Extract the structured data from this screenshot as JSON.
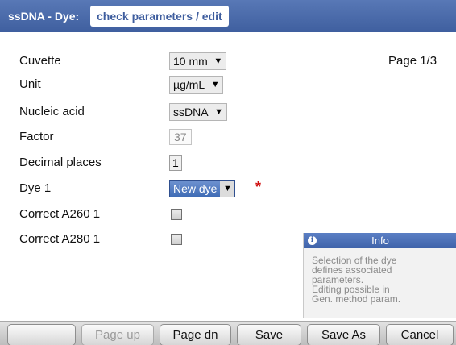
{
  "header": {
    "prefix": "ssDNA - Dye:",
    "tab": "check parameters / edit"
  },
  "page_indicator": "Page 1/3",
  "form": {
    "cuvette": {
      "label": "Cuvette",
      "value": "10 mm"
    },
    "unit": {
      "label": "Unit",
      "value": "µg/mL"
    },
    "nucleic_acid": {
      "label": "Nucleic acid",
      "value": "ssDNA"
    },
    "factor": {
      "label": "Factor",
      "value": "37"
    },
    "decimal_places": {
      "label": "Decimal places",
      "value": "1"
    },
    "dye1": {
      "label": "Dye 1",
      "value": "New dye",
      "required_mark": "*"
    },
    "correct_a260": {
      "label": "Correct A260 1",
      "checked": false
    },
    "correct_a280": {
      "label": "Correct A280 1",
      "checked": false
    }
  },
  "info": {
    "icon": "info-icon",
    "title": "Info",
    "text": "Selection of the dye\ndefines associated\nparameters.\nEditing possible in\nGen. method param."
  },
  "buttons": {
    "blank": "",
    "page_up": "Page up",
    "page_dn": "Page dn",
    "save": "Save",
    "save_as": "Save As",
    "cancel": "Cancel"
  },
  "colors": {
    "header_blue": "#3f5f9f",
    "selection_blue": "#3f6cb6",
    "required_red": "#d01010"
  }
}
